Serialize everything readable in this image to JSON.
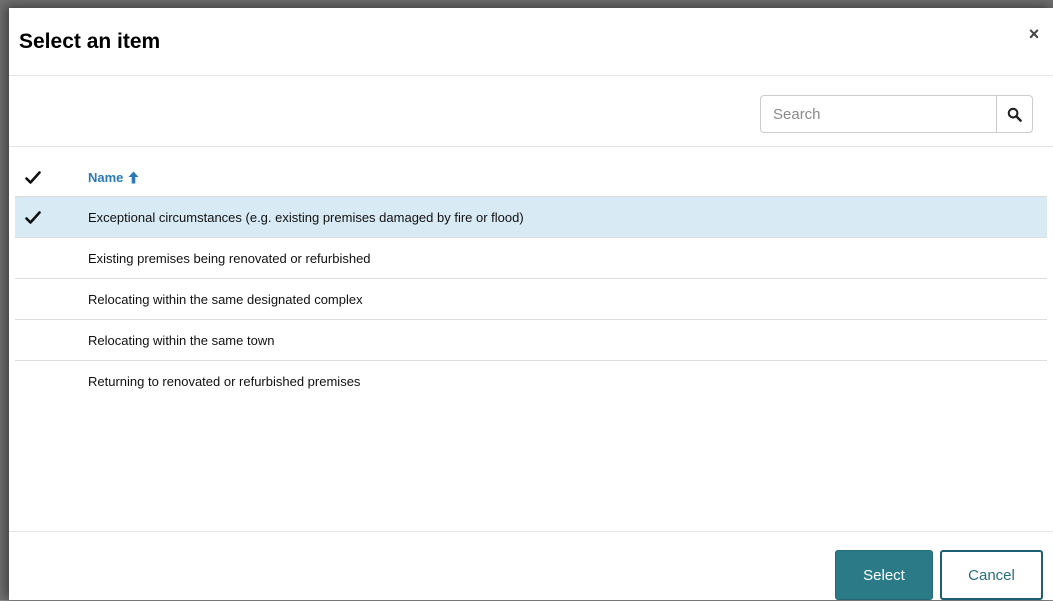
{
  "dialog": {
    "title": "Select an item",
    "close_symbol": "×"
  },
  "search": {
    "placeholder": "Search",
    "value": "",
    "button_icon": "search-icon"
  },
  "grid": {
    "columns": [
      {
        "key": "check",
        "label": "",
        "icon": "checkmark-icon"
      },
      {
        "key": "name",
        "label": "Name",
        "sort": "ascending",
        "sort_icon": "arrow-up-icon"
      }
    ],
    "rows": [
      {
        "name": "Exceptional circumstances (e.g. existing premises damaged by fire or flood)",
        "selected": true
      },
      {
        "name": "Existing premises being renovated or refurbished",
        "selected": false
      },
      {
        "name": "Relocating within the same designated complex",
        "selected": false
      },
      {
        "name": "Relocating within the same town",
        "selected": false
      },
      {
        "name": "Returning to renovated or refurbished premises",
        "selected": false
      }
    ]
  },
  "footer": {
    "select_label": "Select",
    "cancel_label": "Cancel"
  },
  "colors": {
    "accent_link": "#2a7ab8",
    "primary_button": "#2a7b87",
    "selected_row": "#d8eaf4",
    "cancel_border": "#1f5f73"
  }
}
